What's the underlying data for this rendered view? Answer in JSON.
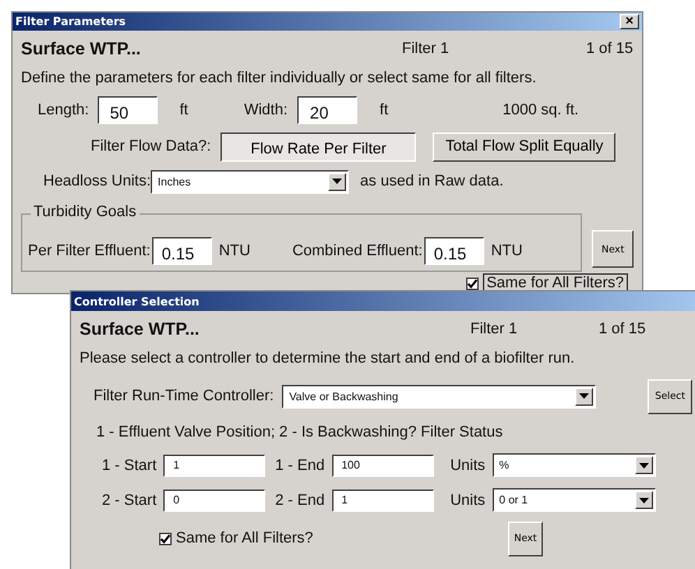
{
  "filter_parameters": {
    "title": "Filter Parameters",
    "close": "×",
    "plant": "Surface WTP...",
    "filter": "Filter 1",
    "position": "1 of 15",
    "instructions": "Define the parameters for each filter individually or select same for all filters.",
    "length": {
      "label": "Length:",
      "value": "50",
      "unit": "ft"
    },
    "width": {
      "label": "Width:",
      "value": "20",
      "unit": "ft"
    },
    "area": "1000 sq. ft.",
    "flow_data": {
      "label": "Filter Flow Data?:",
      "options": [
        {
          "label": "Flow Rate Per Filter",
          "selected": true
        },
        {
          "label": "Total Flow Split Equally",
          "selected": false
        }
      ]
    },
    "headloss": {
      "label": "Headloss Units:",
      "value": "Inches",
      "note": "as used in Raw data."
    },
    "turbidity": {
      "legend": "Turbidity Goals",
      "fields": [
        {
          "label": "Per Filter Effluent:",
          "value": "0.15",
          "unit": "NTU"
        },
        {
          "label": "Combined Effluent:",
          "value": "0.15",
          "unit": "NTU"
        }
      ]
    },
    "next": "Next",
    "same_for_all": {
      "label": "Same for All Filters?",
      "checked": true
    }
  },
  "controller_selection": {
    "title": "Controller Selection",
    "plant": "Surface WTP...",
    "filter": "Filter 1",
    "position": "1 of 15",
    "instructions": "Please select a controller to determine the start and end of a biofilter run.",
    "controller": {
      "label": "Filter Run-Time Controller:",
      "value": "Valve or Backwashing"
    },
    "select": "Select",
    "legend": "1 - Effluent Valve Position; 2 - Is Backwashing? Filter Status",
    "ranges": [
      {
        "start_label": "1 - Start",
        "start": "1",
        "end_label": "1 - End",
        "end": "100",
        "units_label": "Units",
        "units": "%"
      },
      {
        "start_label": "2 - Start",
        "start": "0",
        "end_label": "2 - End",
        "end": "1",
        "units_label": "Units",
        "units": "0 or 1"
      }
    ],
    "same_for_all": {
      "label": "Same for All Filters?",
      "checked": true
    },
    "next": "Next"
  }
}
